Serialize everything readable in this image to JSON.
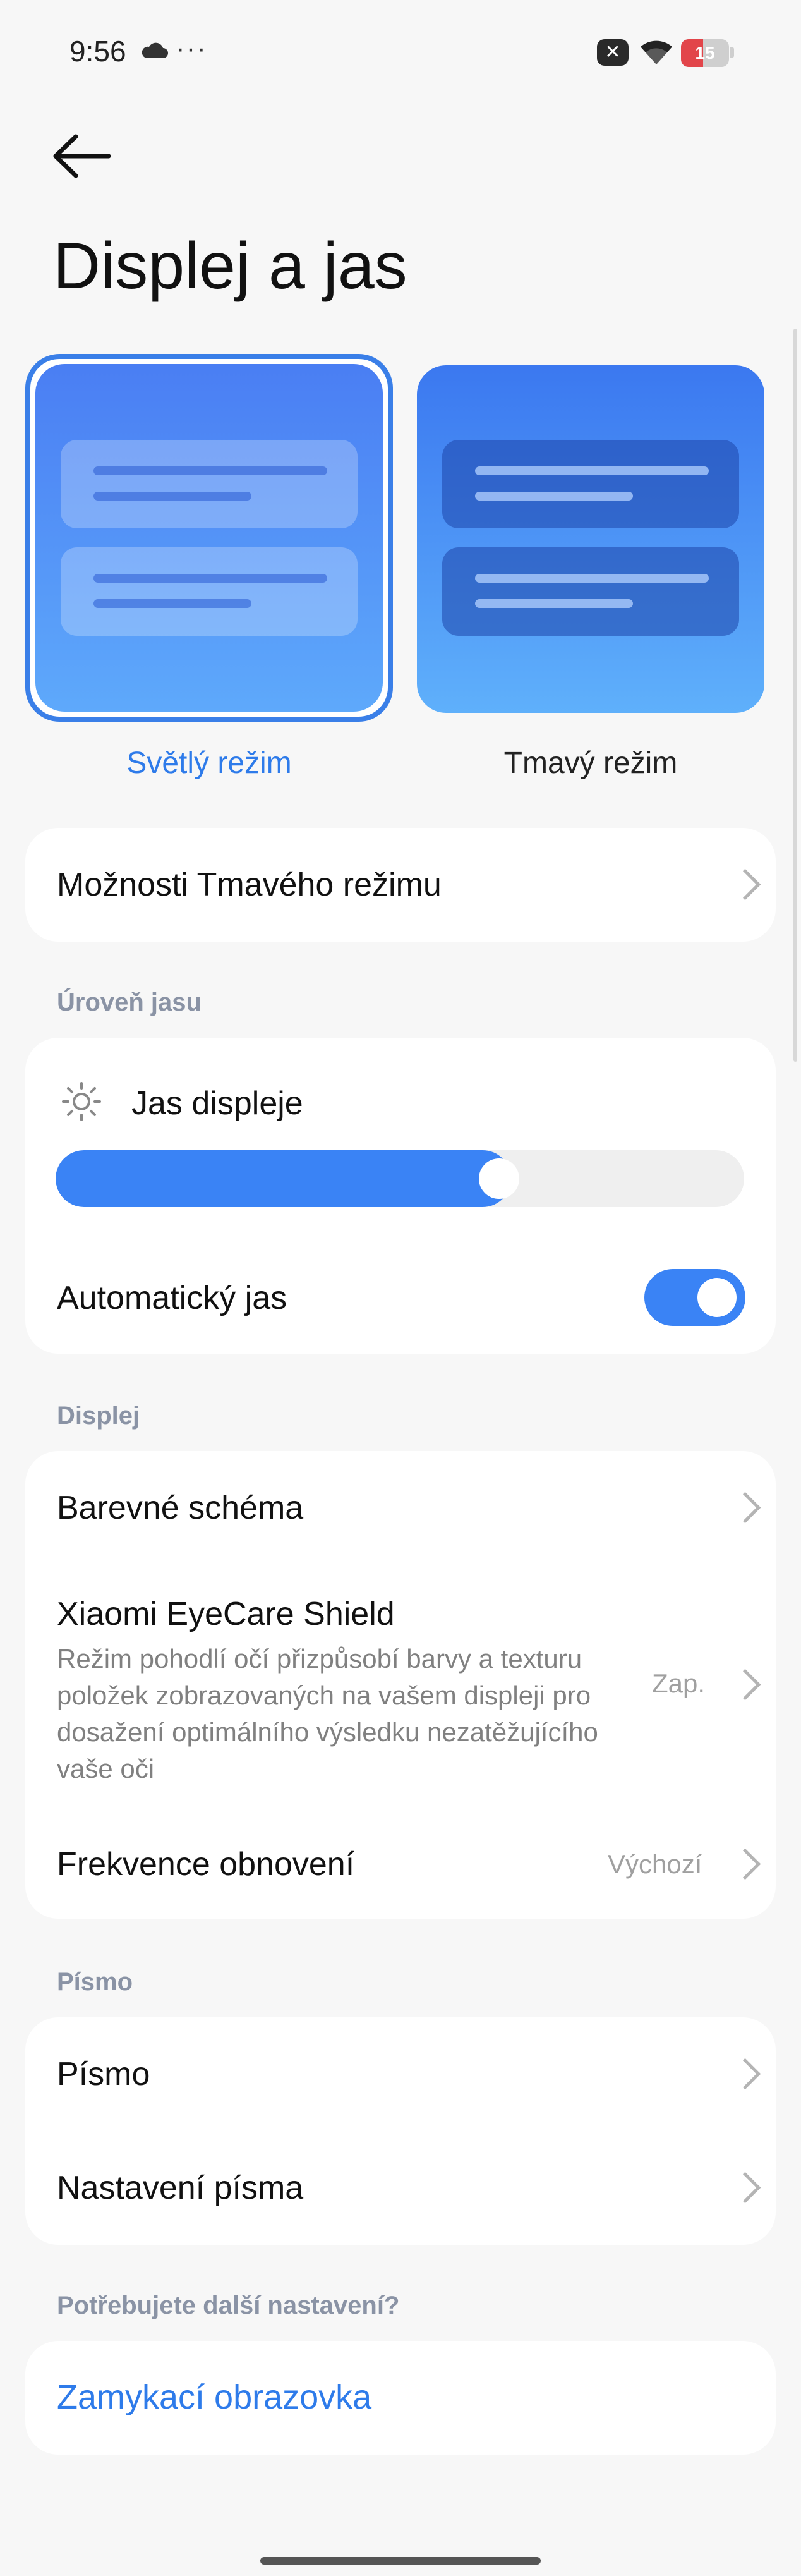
{
  "status_bar": {
    "time": "9:56",
    "more": "···",
    "x_badge": "✕",
    "battery_level": "15",
    "battery_fraction": 0.15,
    "battery_color": "#e2454a"
  },
  "page": {
    "title": "Displej a jas"
  },
  "themes": {
    "light_label": "Světlý režim",
    "dark_label": "Tmavý režim",
    "selected": "light",
    "accent": "#2e7bea"
  },
  "dark_mode_options": {
    "label": "Možnosti Tmavého režimu"
  },
  "brightness": {
    "section_title": "Úroveň jasu",
    "label": "Jas displeje",
    "level": 0.62,
    "auto_label": "Automatický jas",
    "auto_enabled": true
  },
  "display": {
    "section_title": "Displej",
    "color_scheme": "Barevné schéma",
    "eyecare_title": "Xiaomi EyeCare Shield",
    "eyecare_desc_1": "Režim pohodlí očí přizpůsobí barvy a texturu",
    "eyecare_desc_2": "položek zobrazovaných na vašem displeji pro",
    "eyecare_desc_3": "dosažení optimálního výsledku nezatěžujícího",
    "eyecare_desc_4": "vaše oči",
    "eyecare_value": "Zap.",
    "refresh_label": "Frekvence obnovení",
    "refresh_value": "Výchozí"
  },
  "font": {
    "section_title": "Písmo",
    "font_label": "Písmo",
    "font_settings_label": "Nastavení písma"
  },
  "more": {
    "section_title": "Potřebujete další nastavení?",
    "lock_screen_label": "Zamykací obrazovka"
  }
}
